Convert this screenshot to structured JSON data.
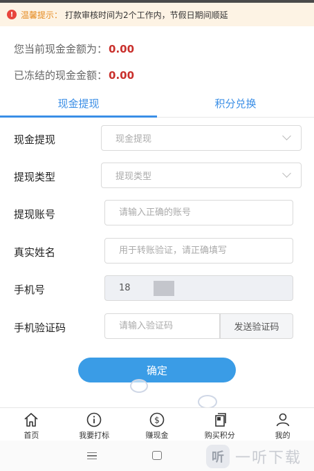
{
  "notice": {
    "label": "温馨提示：",
    "text": "打款审核时间为2个工作内，节假日期间顺延"
  },
  "balance": {
    "current_label": "您当前现金金额为：",
    "current_value": "0.00",
    "frozen_label": "已冻结的现金金额：",
    "frozen_value": "0.00"
  },
  "tabs": [
    {
      "label": "现金提现",
      "active": true
    },
    {
      "label": "积分兑换",
      "active": false
    }
  ],
  "form": {
    "withdraw_label": "现金提现",
    "withdraw_placeholder": "现金提现",
    "type_label": "提现类型",
    "type_placeholder": "提现类型",
    "account_label": "提现账号",
    "account_placeholder": "请输入正确的账号",
    "name_label": "真实姓名",
    "name_placeholder": "用于转账验证，请正确填写",
    "phone_label": "手机号",
    "phone_value": "18",
    "code_label": "手机验证码",
    "code_placeholder": "请输入验证码",
    "send_code_label": "发送验证码",
    "confirm_label": "确定"
  },
  "bottom_nav": [
    {
      "label": "首页",
      "icon": "home-icon"
    },
    {
      "label": "我要打标",
      "icon": "info-icon"
    },
    {
      "label": "赚现金",
      "icon": "dollar-icon"
    },
    {
      "label": "购买积分",
      "icon": "document-icon"
    },
    {
      "label": "我的",
      "icon": "user-icon"
    }
  ],
  "watermark": {
    "logo": "听",
    "text": "一听下载"
  },
  "colors": {
    "accent": "#3a8ee6",
    "amount": "#c9302c",
    "notice_bg": "#fdf3e4",
    "warning": "#e8453c"
  }
}
